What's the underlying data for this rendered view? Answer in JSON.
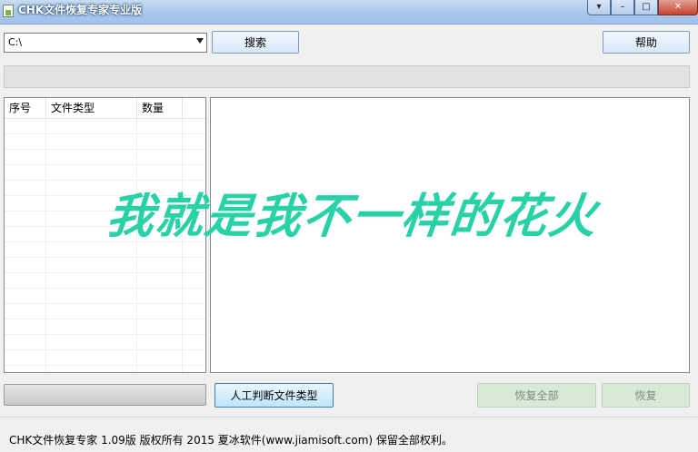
{
  "window": {
    "title": "CHK文件恢复专家专业版",
    "controls": {
      "menu": "▾",
      "minimize": "–",
      "maximize": "□",
      "close": "✕"
    }
  },
  "toolbar": {
    "drive_value": "C:\\",
    "search_label": "搜索",
    "help_label": "帮助"
  },
  "path_bar": {
    "value": ""
  },
  "file_list": {
    "columns": [
      "序号",
      "文件类型",
      "数量",
      ""
    ],
    "rows": []
  },
  "watermark": {
    "text": "我就是我不一样的花火",
    "color": "#29d1a6"
  },
  "progress": {
    "value": 0
  },
  "actions": {
    "manual_label": "人工判断文件类型",
    "recover_all_label": "恢复全部",
    "recover_label": "恢复"
  },
  "status": {
    "text": "CHK文件恢复专家 1.09版  版权所有 2015 夏冰软件(www.jiamisoft.com) 保留全部权利。"
  }
}
